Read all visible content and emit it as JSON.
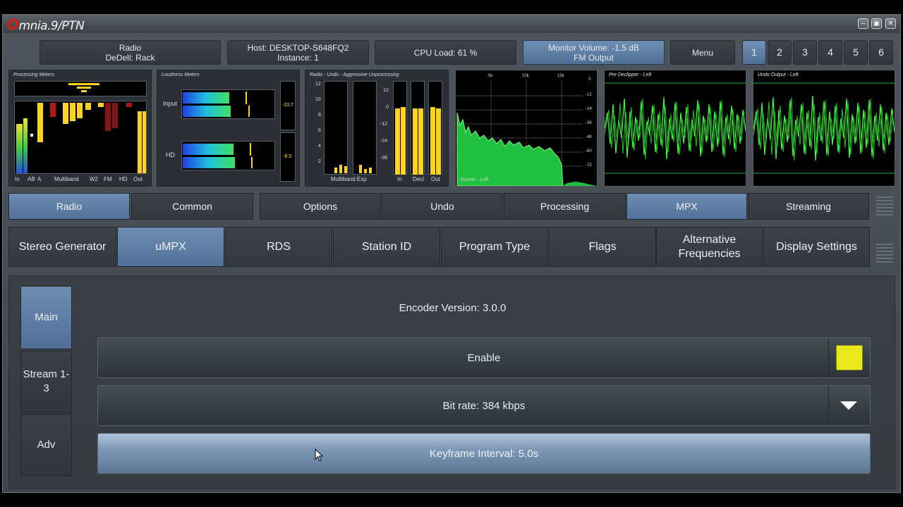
{
  "app": {
    "logo": "mnia.9/PTN",
    "logo_letter": "O"
  },
  "window_controls": {
    "minimize": "–",
    "restore": "▣",
    "close": "✕"
  },
  "status": {
    "radio_line1": "Radio",
    "radio_line2": "DeDell: Rack",
    "host_line1": "Host: DESKTOP-S648FQ2",
    "host_line2": "Instance: 1",
    "cpu": "CPU Load: 61 %",
    "monitor_line1": "Monitor Volume: -1.5 dB",
    "monitor_line2": "FM Output",
    "menu": "Menu"
  },
  "presets": [
    "1",
    "2",
    "3",
    "4",
    "5",
    "6"
  ],
  "meters": {
    "processing": {
      "title": "Processing Meters",
      "labels": [
        "In",
        "AB",
        "A",
        "Multiband",
        "W2",
        "FM",
        "HD",
        "Out"
      ]
    },
    "loudness": {
      "title": "Loudness Meters",
      "input_label": "Input",
      "hd_label": "HD",
      "input_value": "-10.7",
      "hd_value": "-8.3"
    },
    "undo": {
      "title": "Radio - Undo - Aggressive Unprocessing",
      "left_scale": [
        "12",
        "10",
        "8",
        "6",
        "4",
        "2"
      ],
      "right_scale": [
        "12",
        "0",
        "-12",
        "-24",
        "-36"
      ],
      "labels": [
        "Multiband Exp",
        "In",
        "Decl",
        "Out"
      ]
    },
    "spectrum": {
      "title": "Source - Left",
      "freq_labels": [
        "5k",
        "10k",
        "15k"
      ],
      "db_labels": [
        "0",
        "-12",
        "-24",
        "-36",
        "-48",
        "-60",
        "-72"
      ]
    },
    "scope1": {
      "title": "Pre Declipper - Left"
    },
    "scope2": {
      "title": "Undo Output - Left"
    }
  },
  "tabs": [
    {
      "label": "Radio",
      "active": true
    },
    {
      "label": "Common",
      "active": false
    },
    {
      "label": "Options",
      "active": false
    },
    {
      "label": "Undo",
      "active": false
    },
    {
      "label": "Processing",
      "active": false
    },
    {
      "label": "MPX",
      "active": true
    },
    {
      "label": "Streaming",
      "active": false
    }
  ],
  "subtabs": [
    {
      "label": "Stereo Generator",
      "active": false
    },
    {
      "label": "uMPX",
      "active": true
    },
    {
      "label": "RDS",
      "active": false
    },
    {
      "label": "Station ID",
      "active": false
    },
    {
      "label": "Program Type",
      "active": false
    },
    {
      "label": "Flags",
      "active": false
    },
    {
      "label": "Alternative Frequencies",
      "active": false
    },
    {
      "label": "Display Settings",
      "active": false
    }
  ],
  "side": [
    {
      "label": "Main",
      "active": true
    },
    {
      "label": "Stream 1-3",
      "active": false
    },
    {
      "label": "Adv",
      "active": false
    }
  ],
  "main": {
    "encoder_version": "Encoder Version: 3.0.0",
    "enable": "Enable",
    "enable_color": "#e8e81a",
    "bitrate": "Bit rate: 384 kbps",
    "keyframe": "Keyframe Interval: 5.0s"
  }
}
